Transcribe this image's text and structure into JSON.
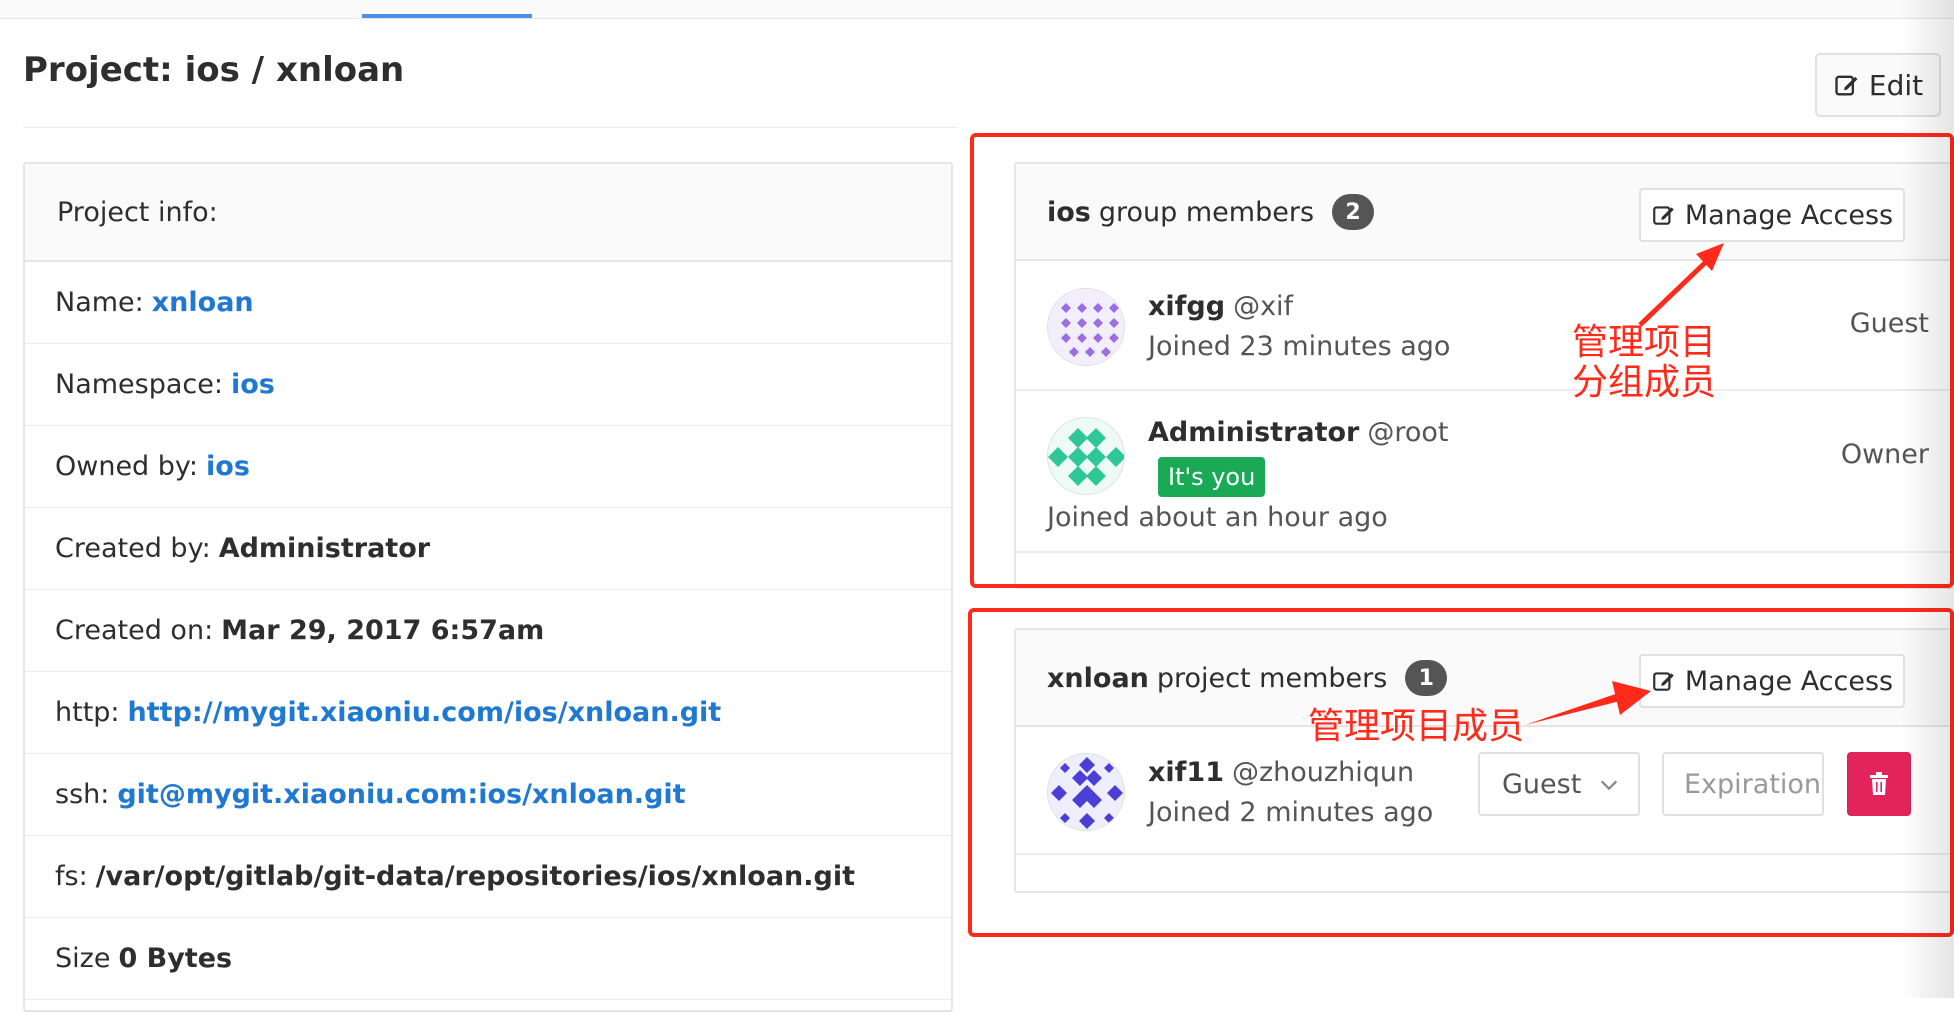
{
  "page": {
    "title": "Project: ios / xnloan",
    "edit_label": "Edit"
  },
  "project_info": {
    "header": "Project info:",
    "rows": [
      {
        "label": "Name:",
        "value": "xnloan",
        "style": "link"
      },
      {
        "label": "Namespace:",
        "value": "ios",
        "style": "link"
      },
      {
        "label": "Owned by:",
        "value": "ios",
        "style": "link"
      },
      {
        "label": "Created by:",
        "value": "Administrator",
        "style": "bold"
      },
      {
        "label": "Created on:",
        "value": "Mar 29, 2017 6:57am",
        "style": "bold"
      },
      {
        "label": "http:",
        "value": "http://mygit.xiaoniu.com/ios/xnloan.git",
        "style": "link"
      },
      {
        "label": "ssh:",
        "value": "git@mygit.xiaoniu.com:ios/xnloan.git",
        "style": "link"
      },
      {
        "label": "fs:",
        "value": "/var/opt/gitlab/git-data/repositories/ios/xnloan.git",
        "style": "bold"
      },
      {
        "label": "Size",
        "value": "0 Bytes",
        "style": "bold"
      }
    ]
  },
  "group_members": {
    "group_name": "ios",
    "title_suffix": "group members",
    "count": "2",
    "manage_label": "Manage Access",
    "members": [
      {
        "name": "xifgg",
        "username": "@xif",
        "joined": "Joined 23 minutes ago",
        "role": "Guest",
        "avatar": "purple-identicon"
      },
      {
        "name": "Administrator",
        "username": "@root",
        "badge": "It's you",
        "joined": "Joined about an hour ago",
        "role": "Owner",
        "avatar": "green-identicon"
      }
    ]
  },
  "project_members": {
    "project_name": "xnloan",
    "title_suffix": "project members",
    "count": "1",
    "manage_label": "Manage Access",
    "members": [
      {
        "name": "xif11",
        "username": "@zhouzhiqun",
        "joined": "Joined 2 minutes ago",
        "role_select": "Guest",
        "expiration_placeholder": "Expiration date",
        "avatar": "blue-identicon"
      }
    ]
  },
  "annotations": {
    "group_line1": "管理项目",
    "group_line2": "分组成员",
    "project": "管理项目成员"
  },
  "colors": {
    "link": "#1f78d1",
    "annotation": "#ff2a1a",
    "you_badge": "#1aaa55",
    "delete": "#e3245b",
    "tab_active": "#4a90e2"
  },
  "icons": {
    "edit": "edit-icon",
    "manage": "edit-icon",
    "delete": "trash-icon",
    "select": "chevron-down-icon"
  }
}
